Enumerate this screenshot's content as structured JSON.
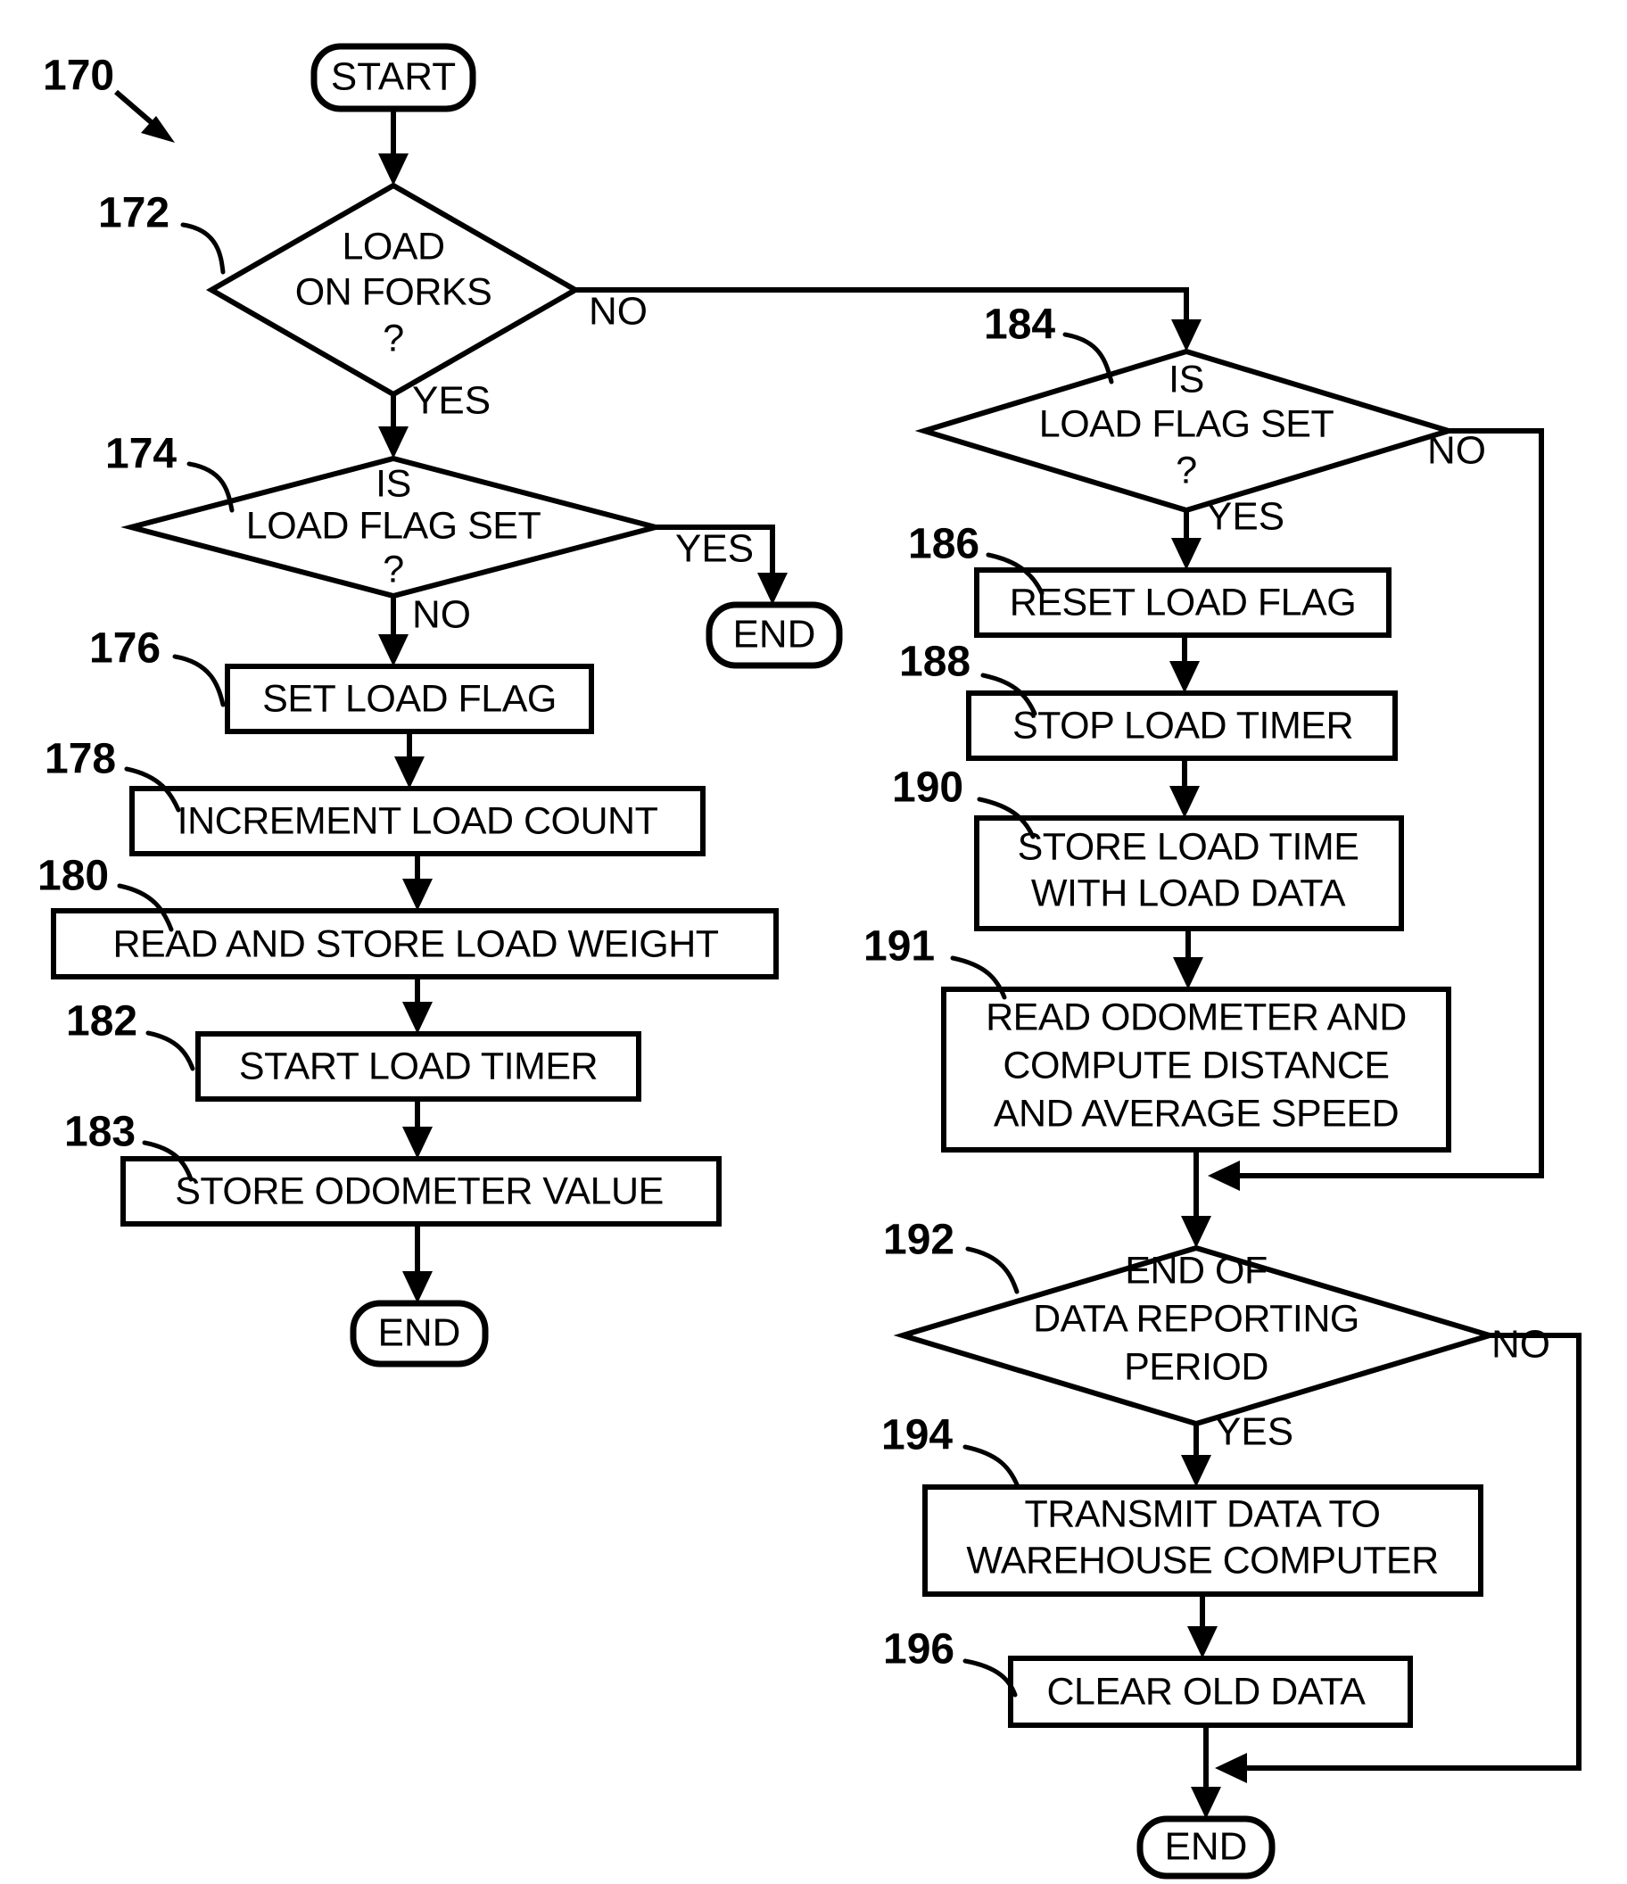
{
  "figure": {
    "reference_numeral": "170",
    "nodes": [
      {
        "id": "start",
        "ref": "",
        "type": "terminator",
        "lines": [
          "START"
        ]
      },
      {
        "id": "n172",
        "ref": "172",
        "type": "decision",
        "lines": [
          "LOAD",
          "ON FORKS",
          "?"
        ]
      },
      {
        "id": "n174",
        "ref": "174",
        "type": "decision",
        "lines": [
          "IS",
          "LOAD FLAG SET",
          "?"
        ]
      },
      {
        "id": "end174",
        "ref": "",
        "type": "terminator",
        "lines": [
          "END"
        ]
      },
      {
        "id": "n176",
        "ref": "176",
        "type": "process",
        "lines": [
          "SET LOAD FLAG"
        ]
      },
      {
        "id": "n178",
        "ref": "178",
        "type": "process",
        "lines": [
          "INCREMENT LOAD COUNT"
        ]
      },
      {
        "id": "n180",
        "ref": "180",
        "type": "process",
        "lines": [
          "READ AND STORE LOAD WEIGHT"
        ]
      },
      {
        "id": "n182",
        "ref": "182",
        "type": "process",
        "lines": [
          "START LOAD TIMER"
        ]
      },
      {
        "id": "n183",
        "ref": "183",
        "type": "process",
        "lines": [
          "STORE ODOMETER VALUE"
        ]
      },
      {
        "id": "endL",
        "ref": "",
        "type": "terminator",
        "lines": [
          "END"
        ]
      },
      {
        "id": "n184",
        "ref": "184",
        "type": "decision",
        "lines": [
          "IS",
          "LOAD FLAG SET",
          "?"
        ]
      },
      {
        "id": "n186",
        "ref": "186",
        "type": "process",
        "lines": [
          "RESET LOAD FLAG"
        ]
      },
      {
        "id": "n188",
        "ref": "188",
        "type": "process",
        "lines": [
          "STOP LOAD TIMER"
        ]
      },
      {
        "id": "n190",
        "ref": "190",
        "type": "process",
        "lines": [
          "STORE LOAD TIME",
          "WITH LOAD DATA"
        ]
      },
      {
        "id": "n191",
        "ref": "191",
        "type": "process",
        "lines": [
          "READ ODOMETER AND",
          "COMPUTE DISTANCE",
          "AND AVERAGE SPEED"
        ]
      },
      {
        "id": "n192",
        "ref": "192",
        "type": "decision",
        "lines": [
          "END OF",
          "DATA REPORTING",
          "PERIOD"
        ]
      },
      {
        "id": "n194",
        "ref": "194",
        "type": "process",
        "lines": [
          "TRANSMIT DATA TO",
          "WAREHOUSE COMPUTER"
        ]
      },
      {
        "id": "n196",
        "ref": "196",
        "type": "process",
        "lines": [
          "CLEAR OLD DATA"
        ]
      },
      {
        "id": "endR",
        "ref": "",
        "type": "terminator",
        "lines": [
          "END"
        ]
      }
    ],
    "edge_labels": {
      "n172_no": "NO",
      "n172_yes": "YES",
      "n174_yes": "YES",
      "n174_no": "NO",
      "n184_no": "NO",
      "n184_yes": "YES",
      "n192_no": "NO",
      "n192_yes": "YES"
    },
    "colors": {
      "ink": "#000000",
      "paper": "#ffffff"
    }
  }
}
